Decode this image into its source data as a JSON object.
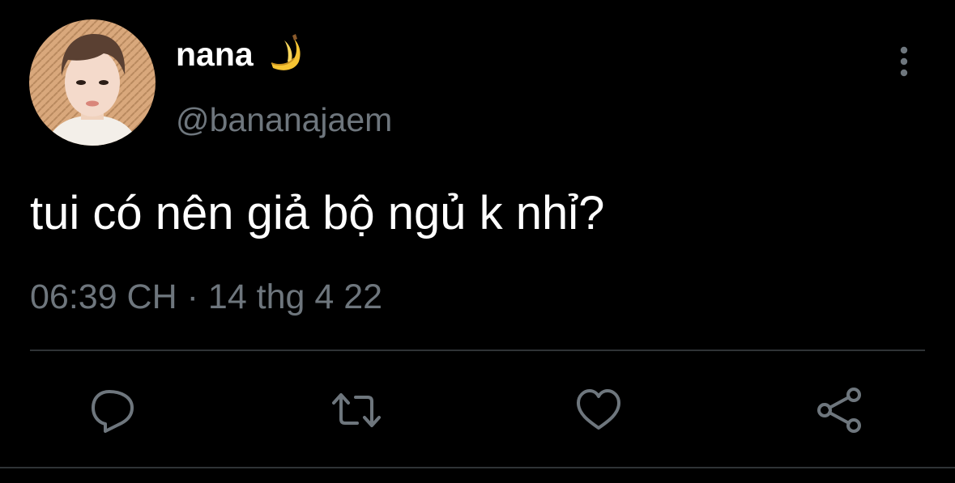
{
  "tweet": {
    "display_name": "nana",
    "name_emoji": "banana-icon",
    "handle": "@bananajaem",
    "text": "tui có nên giả bộ ngủ k nhỉ?",
    "time": "06:39 CH",
    "separator": "·",
    "date": "14 thg 4 22"
  },
  "actions": [
    {
      "name": "reply",
      "icon": "comment-icon"
    },
    {
      "name": "retweet",
      "icon": "retweet-icon"
    },
    {
      "name": "like",
      "icon": "heart-icon"
    },
    {
      "name": "share",
      "icon": "share-icon"
    }
  ],
  "colors": {
    "background": "#000000",
    "primary_text": "#ffffff",
    "secondary_text": "#6e767d",
    "divider": "#2f3336"
  }
}
